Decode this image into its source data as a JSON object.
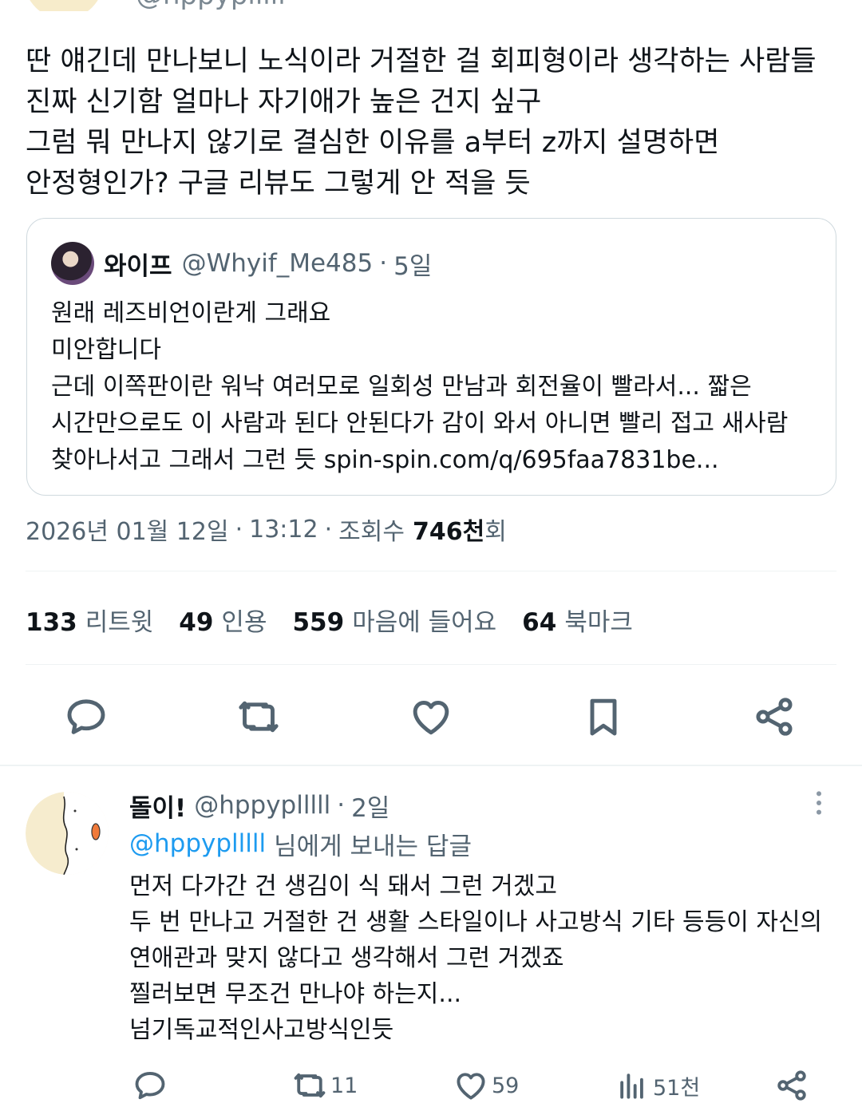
{
  "top_partial": {
    "handle": "@hppyplllll"
  },
  "main_tweet": {
    "text_lines": [
      "딴 얘긴데 만나보니 노식이라 거절한 걸 회피형이라 생각하는 사람들",
      "진짜 신기함 얼마나 자기애가 높은 건지 싶구",
      "그럼 뭐 만나지 않기로 결심한 이유를 a부터 z까지 설명하면",
      "안정형인가? 구글 리뷰도 그렇게 안 적을 듯"
    ],
    "quote": {
      "name": "와이프",
      "handle": "@Whyif_Me485",
      "dot": "·",
      "time": "5일",
      "body_lines": [
        "원래 레즈비언이란게 그래요",
        "미안합니다",
        "근데 이쪽판이란 워낙 여러모로 일회성 만남과 회전율이 빨라서... 짧은",
        "시간만으로도 이 사람과 된다 안된다가 감이 와서 아니면 빨리 접고 새사람",
        "찾아나서고 그래서 그런 듯 spin-spin.com/q/695faa7831be..."
      ]
    },
    "meta": {
      "date": "2026년 01월 12일",
      "sep": "·",
      "time": "13:12",
      "views_prefix": "조회수",
      "views_value": "746천",
      "views_suffix": "회"
    },
    "stats": [
      {
        "num": "133",
        "label": "리트윗"
      },
      {
        "num": "49",
        "label": "인용"
      },
      {
        "num": "559",
        "label": "마음에 들어요"
      },
      {
        "num": "64",
        "label": "북마크"
      }
    ],
    "actions": {
      "reply_icon": "comment-icon",
      "retweet_icon": "retweet-icon",
      "like_icon": "heart-icon",
      "bookmark_icon": "bookmark-icon",
      "share_icon": "share-icon"
    }
  },
  "reply": {
    "name": "돌이!",
    "handle": "@hppyplllll",
    "dot": "·",
    "time": "2일",
    "replying_to_handle": "@hppyplllll",
    "replying_to_text": "님에게 보내는 답글",
    "body_lines": [
      "먼저 다가간 건 생김이 식 돼서 그런 거겠고",
      "두 번 만나고 거절한 건 생활 스타일이나 사고방식 기타 등등이 자신의",
      "연애관과 맞지 않다고 생각해서 그런 거겠죠",
      "찔러보면 무조건 만나야 하는지...",
      "넘기독교적인사고방식인듯"
    ],
    "actions": {
      "retweets": "11",
      "likes": "59",
      "views": "51천"
    }
  },
  "colors": {
    "text": "#0f1419",
    "secondary": "#536471",
    "mention": "#1d9bf0",
    "border": "#cfd9de",
    "divider": "#eff3f4"
  }
}
